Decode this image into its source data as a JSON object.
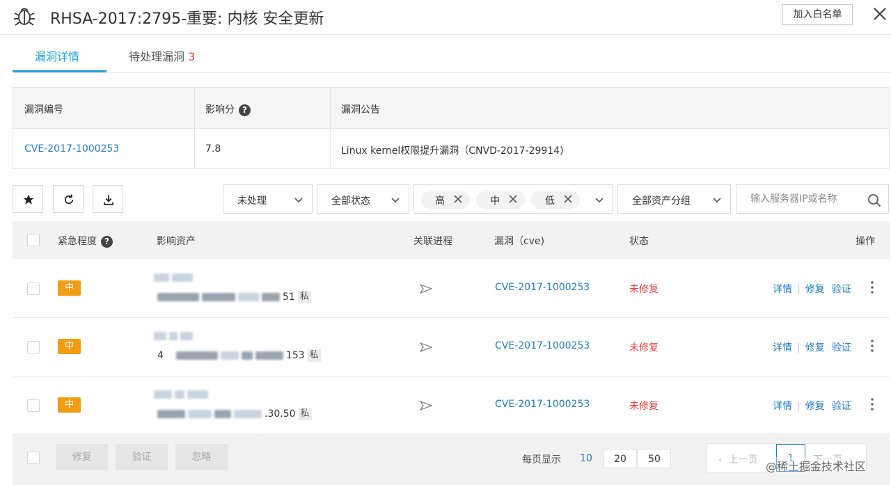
{
  "header": {
    "title": "RHSA-2017:2795-重要: 内核 安全更新",
    "whitelist_button": "加入白名单"
  },
  "tabs": [
    {
      "label": "漏洞详情"
    },
    {
      "label": "待处理漏洞",
      "count": "3"
    }
  ],
  "info_table": {
    "headers": [
      "漏洞编号",
      "影响分",
      "漏洞公告"
    ],
    "cve": "CVE-2017-1000253",
    "score": "7.8",
    "notice": "Linux kernel权限提升漏洞（CNVD-2017-29914)"
  },
  "filters": {
    "process_state": "未处理",
    "all_status": "全部状态",
    "levels": [
      "高",
      "中",
      "低"
    ],
    "asset_group": "全部资产分组",
    "search_placeholder": "输入服务器IP或名称"
  },
  "grid": {
    "headers": {
      "urgency": "紧急程度",
      "asset": "影响资产",
      "process": "关联进程",
      "cve": "漏洞（cve)",
      "status": "状态",
      "ops": "操作"
    },
    "rows": [
      {
        "urgency": "中",
        "asset_suffix": "51",
        "private": "私",
        "cve": "CVE-2017-1000253",
        "status": "未修复"
      },
      {
        "urgency": "中",
        "asset_prefix": "4",
        "asset_suffix": "153",
        "private": "私",
        "cve": "CVE-2017-1000253",
        "status": "未修复"
      },
      {
        "urgency": "中",
        "asset_suffix": ".30.50",
        "private": "私",
        "cve": "CVE-2017-1000253",
        "status": "未修复"
      }
    ],
    "ops": {
      "detail": "详情",
      "fix": "修复",
      "verify": "验证"
    }
  },
  "footer": {
    "fix": "修复",
    "verify": "验证",
    "ignore": "忽略",
    "per_page_label": "每页显示",
    "page_sizes": [
      "10",
      "20",
      "50"
    ],
    "prev": "上一页",
    "current_page": "1",
    "next": "下一页"
  },
  "watermark": "@稀土掘金技术社区",
  "colors": {
    "accent": "#20a3d9",
    "link": "#1e7bc9",
    "danger": "#e84343",
    "urgency_medium": "#f39c12"
  }
}
